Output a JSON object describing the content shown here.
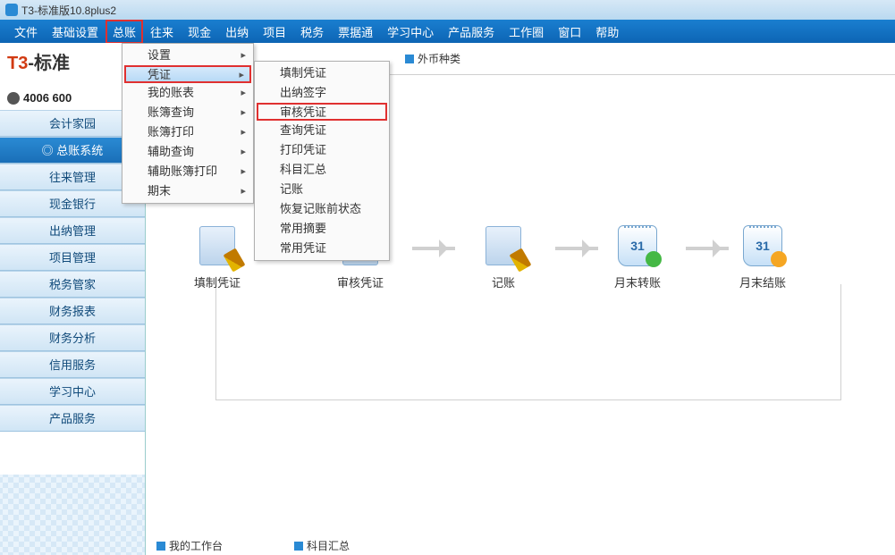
{
  "title_bar": {
    "title": "T3-标准版10.8plus2"
  },
  "menu_bar": {
    "items": [
      "文件",
      "基础设置",
      "总账",
      "往来",
      "现金",
      "出纳",
      "项目",
      "税务",
      "票据通",
      "学习中心",
      "产品服务",
      "工作圈",
      "窗口",
      "帮助"
    ],
    "highlighted_index": 2
  },
  "brand": {
    "t3_red": "T3",
    "t3_rest": "-标准",
    "phone": "4006 600"
  },
  "sidebar": {
    "items": [
      "会计家园",
      "总账系统",
      "往来管理",
      "现金银行",
      "出纳管理",
      "项目管理",
      "税务管家",
      "财务报表",
      "财务分析",
      "信用服务",
      "学习中心",
      "产品服务"
    ],
    "active_index": 1
  },
  "toolbar": {
    "currency_label": "外币种类"
  },
  "submenu1": {
    "items": [
      {
        "label": "设置",
        "arrow": true
      },
      {
        "label": "凭证",
        "arrow": true,
        "highlight": true,
        "boxed": true
      },
      {
        "label": "我的账表",
        "arrow": true
      },
      {
        "label": "账簿查询",
        "arrow": true
      },
      {
        "label": "账簿打印",
        "arrow": true
      },
      {
        "label": "辅助查询",
        "arrow": true
      },
      {
        "label": "辅助账簿打印",
        "arrow": true
      },
      {
        "label": "期末",
        "arrow": true
      }
    ]
  },
  "submenu2": {
    "items": [
      {
        "label": "填制凭证"
      },
      {
        "label": "出纳签字"
      },
      {
        "label": "审核凭证",
        "boxed": true
      },
      {
        "label": "查询凭证"
      },
      {
        "label": "打印凭证"
      },
      {
        "label": "科目汇总"
      },
      {
        "label": "记账"
      },
      {
        "label": "恢复记账前状态"
      },
      {
        "label": "常用摘要"
      },
      {
        "label": "常用凭证"
      }
    ]
  },
  "workflow": {
    "nodes": [
      "填制凭证",
      "审核凭证",
      "记账",
      "月末转账",
      "月末结账"
    ]
  },
  "bottom_tabs": {
    "items": [
      "我的工作台",
      "科目汇总"
    ]
  }
}
